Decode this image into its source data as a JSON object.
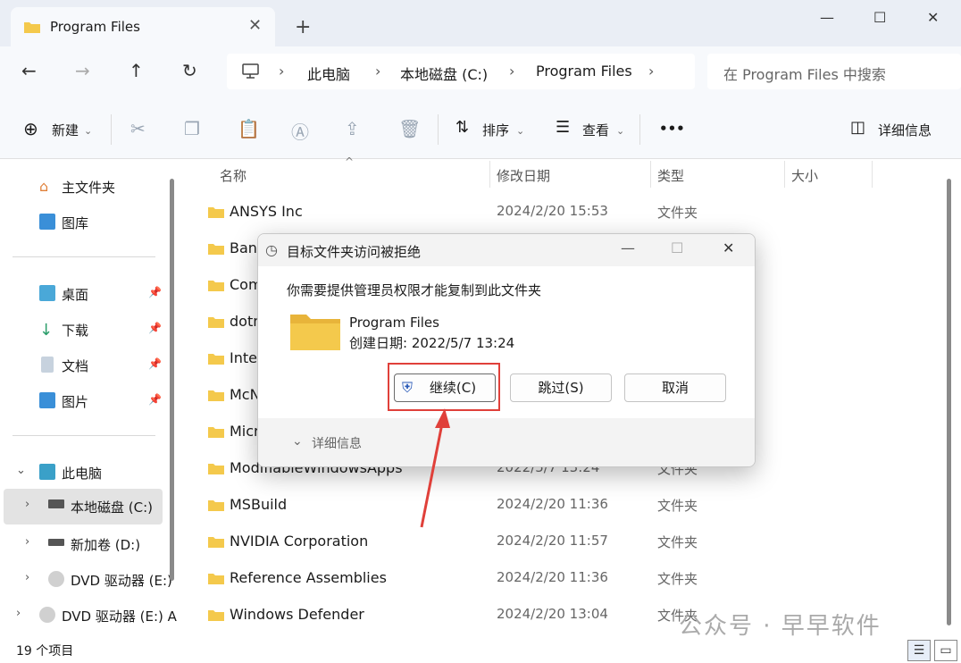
{
  "window": {
    "tab_title": "Program Files",
    "new_tab": "+",
    "minimize": "—",
    "maximize": "☐",
    "close": "✕"
  },
  "address": {
    "crumbs": [
      "此电脑",
      "本地磁盘 (C:)",
      "Program Files"
    ],
    "search_placeholder": "在 Program Files 中搜索"
  },
  "toolbar": {
    "new_label": "新建",
    "sort_label": "排序",
    "view_label": "查看",
    "more_label": "•••",
    "details_label": "详细信息"
  },
  "sidebar": {
    "items": [
      {
        "label": "主文件夹"
      },
      {
        "label": "图库"
      },
      {
        "label": "桌面"
      },
      {
        "label": "下载"
      },
      {
        "label": "文档"
      },
      {
        "label": "图片"
      },
      {
        "label": "此电脑"
      },
      {
        "label": "本地磁盘 (C:)"
      },
      {
        "label": "新加卷 (D:)"
      },
      {
        "label": "DVD 驱动器 (E:)"
      },
      {
        "label": "DVD 驱动器 (E:) A"
      }
    ]
  },
  "columns": {
    "name": "名称",
    "date": "修改日期",
    "type": "类型",
    "size": "大小"
  },
  "files": [
    {
      "name": "ANSYS Inc",
      "date": "2024/2/20 15:53",
      "type": "文件夹"
    },
    {
      "name": "Band",
      "date": "",
      "type": ""
    },
    {
      "name": "Com",
      "date": "",
      "type": ""
    },
    {
      "name": "dotn",
      "date": "",
      "type": ""
    },
    {
      "name": "Inter",
      "date": "",
      "type": ""
    },
    {
      "name": "McN",
      "date": "",
      "type": ""
    },
    {
      "name": "Micr",
      "date": "",
      "type": ""
    },
    {
      "name": "ModifiableWindowsApps",
      "date": "2022/5/7 13:24",
      "type": "文件夹"
    },
    {
      "name": "MSBuild",
      "date": "2024/2/20 11:36",
      "type": "文件夹"
    },
    {
      "name": "NVIDIA Corporation",
      "date": "2024/2/20 11:57",
      "type": "文件夹"
    },
    {
      "name": "Reference Assemblies",
      "date": "2024/2/20 11:36",
      "type": "文件夹"
    },
    {
      "name": "Windows Defender",
      "date": "2024/2/20 13:04",
      "type": "文件夹"
    }
  ],
  "status": {
    "count": "19 个项目"
  },
  "watermark": "公众号 · 早早软件",
  "dialog": {
    "title": "目标文件夹访问被拒绝",
    "message": "你需要提供管理员权限才能复制到此文件夹",
    "folder_name": "Program Files",
    "created": "创建日期: 2022/5/7 13:24",
    "continue_label": "继续(C)",
    "skip_label": "跳过(S)",
    "cancel_label": "取消",
    "details_label": "详细信息"
  },
  "colors": {
    "folder": "#f4c94c",
    "highlight": "#e0403a",
    "selected_row": "#e3e3e3"
  }
}
